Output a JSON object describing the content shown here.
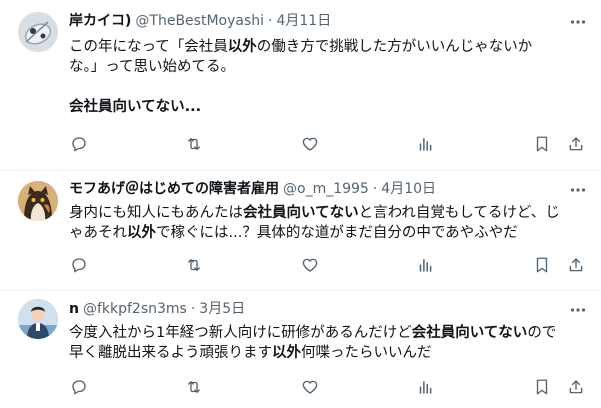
{
  "tweets": [
    {
      "name": "岸カイコ)",
      "handle": "@TheBestMoyashi",
      "sep": "·",
      "date": "4月11日",
      "line1_a": "この年になって「会社員",
      "line1_b": "以外",
      "line1_c": "の働き方で挑戦した方がいいんじゃないか",
      "line2": "な。」って思い始めてる。",
      "line3": "会社員向いてない..."
    },
    {
      "name": "モフあげ＠はじめての障害者雇用",
      "handle": "@o_m_1995",
      "sep": "·",
      "date": "4月10日",
      "line1_a": "身内にも知人にもあんたは",
      "line1_b": "会社員向いてない",
      "line1_c": "と言われ自覚もしてるけど、じ",
      "line2_a": "ゃあそれ",
      "line2_b": "以外",
      "line2_c": "で稼ぐには...？具体的な道がまだ自分の中であやふやだ"
    },
    {
      "name": "n",
      "handle": "@fkkpf2sn3ms",
      "sep": "·",
      "date": "3月5日",
      "line1_a": "今度入社から1年経つ新人向けに研修があるんだけど",
      "line1_b": "会社員向いてない",
      "line1_c": "ので",
      "line2_a": "早く離脱出来るよう頑張ります",
      "line2_b": "以外",
      "line2_c": "何喋ったらいいんだ"
    }
  ],
  "colors": {
    "text": "#0f1419",
    "muted": "#536471",
    "divider": "#eff3f4"
  },
  "icons": [
    "reply-icon",
    "retweet-icon",
    "like-icon",
    "views-icon",
    "bookmark-icon",
    "share-icon",
    "more-icon"
  ]
}
